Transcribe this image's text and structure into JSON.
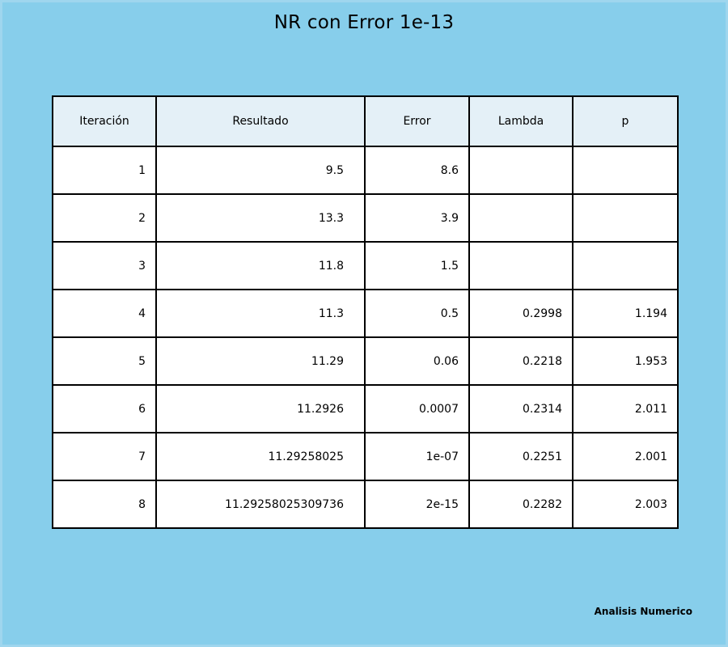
{
  "chart_data": {
    "type": "table",
    "title": "NR con Error 1e-13",
    "columns": [
      "Iteración",
      "Resultado",
      "Error",
      "Lambda",
      "p"
    ],
    "rows": [
      [
        "1",
        "9.5",
        "8.6",
        "",
        ""
      ],
      [
        "2",
        "13.3",
        "3.9",
        "",
        ""
      ],
      [
        "3",
        "11.8",
        "1.5",
        "",
        ""
      ],
      [
        "4",
        "11.3",
        "0.5",
        "0.2998",
        "1.194"
      ],
      [
        "5",
        "11.29",
        "0.06",
        "0.2218",
        "1.953"
      ],
      [
        "6",
        "11.2926",
        "0.0007",
        "0.2314",
        "2.011"
      ],
      [
        "7",
        "11.29258025",
        "1e-07",
        "0.2251",
        "2.001"
      ],
      [
        "8",
        "11.29258025309736",
        "2e-15",
        "0.2282",
        "2.003"
      ]
    ],
    "footer": "Analisis Numerico"
  },
  "colors": {
    "background": "#87ceeb",
    "header_fill": "#e4f0f7",
    "cell_fill": "#ffffff",
    "grid": "#000000"
  }
}
